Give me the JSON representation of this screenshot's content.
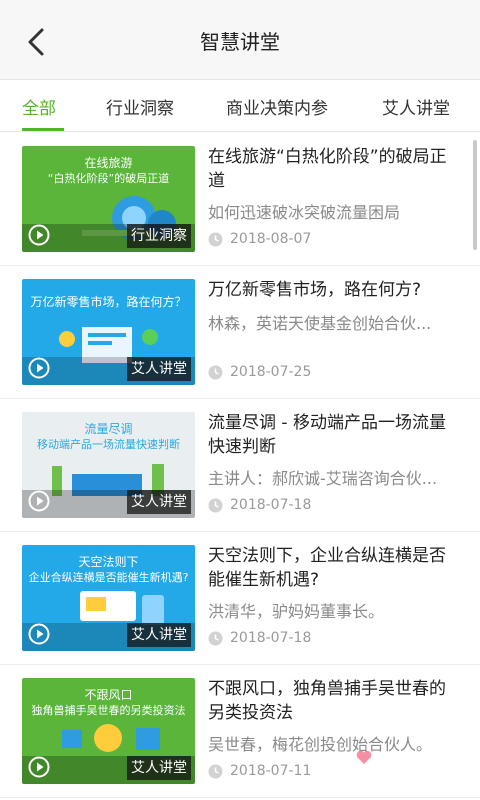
{
  "header": {
    "title": "智慧讲堂",
    "back_icon": "back-arrow-icon"
  },
  "tabs": [
    {
      "label": "全部",
      "active": true
    },
    {
      "label": "行业洞察",
      "active": false
    },
    {
      "label": "商业决策内参",
      "active": false
    },
    {
      "label": "艾人讲堂",
      "active": false
    }
  ],
  "colors": {
    "accent": "#52b52d",
    "thumb_green": "#5ab53a",
    "thumb_blue": "#23a9e8",
    "thumb_light": "#e9eef1"
  },
  "items": [
    {
      "thumb_line1": "在线旅游",
      "thumb_line2": "“白热化阶段”的破局正道",
      "category": "行业洞察",
      "title": "在线旅游“白热化阶段”的破局正道",
      "subtitle": "如何迅速破冰突破流量困局",
      "date": "2018-08-07"
    },
    {
      "thumb_line1": "万亿新零售市场，路在何方？",
      "thumb_line2": "",
      "category": "艾人讲堂",
      "title": "万亿新零售市场，路在何方?",
      "subtitle": "林森，英诺天使基金创始合伙...",
      "date": "2018-07-25"
    },
    {
      "thumb_line1": "流量尽调",
      "thumb_line2": "移动端产品一场流量快速判断",
      "category": "艾人讲堂",
      "title": "流量尽调 - 移动端产品一场流量快速判断",
      "subtitle": "主讲人：郝欣诚-艾瑞咨询合伙...",
      "date": "2018-07-18"
    },
    {
      "thumb_line1": "天空法则下",
      "thumb_line2": "企业合纵连横是否能催生新机遇?",
      "category": "艾人讲堂",
      "title": "天空法则下，企业合纵连横是否能催生新机遇?",
      "subtitle": "洪清华，驴妈妈董事长。",
      "date": "2018-07-18"
    },
    {
      "thumb_line1": "不跟风口",
      "thumb_line2": "独角兽捕手吴世春的另类投资法",
      "category": "艾人讲堂",
      "title": "不跟风口，独角兽捕手吴世春的另类投资法",
      "subtitle": "吴世春，梅花创投创始合伙人。",
      "date": "2018-07-11"
    }
  ]
}
